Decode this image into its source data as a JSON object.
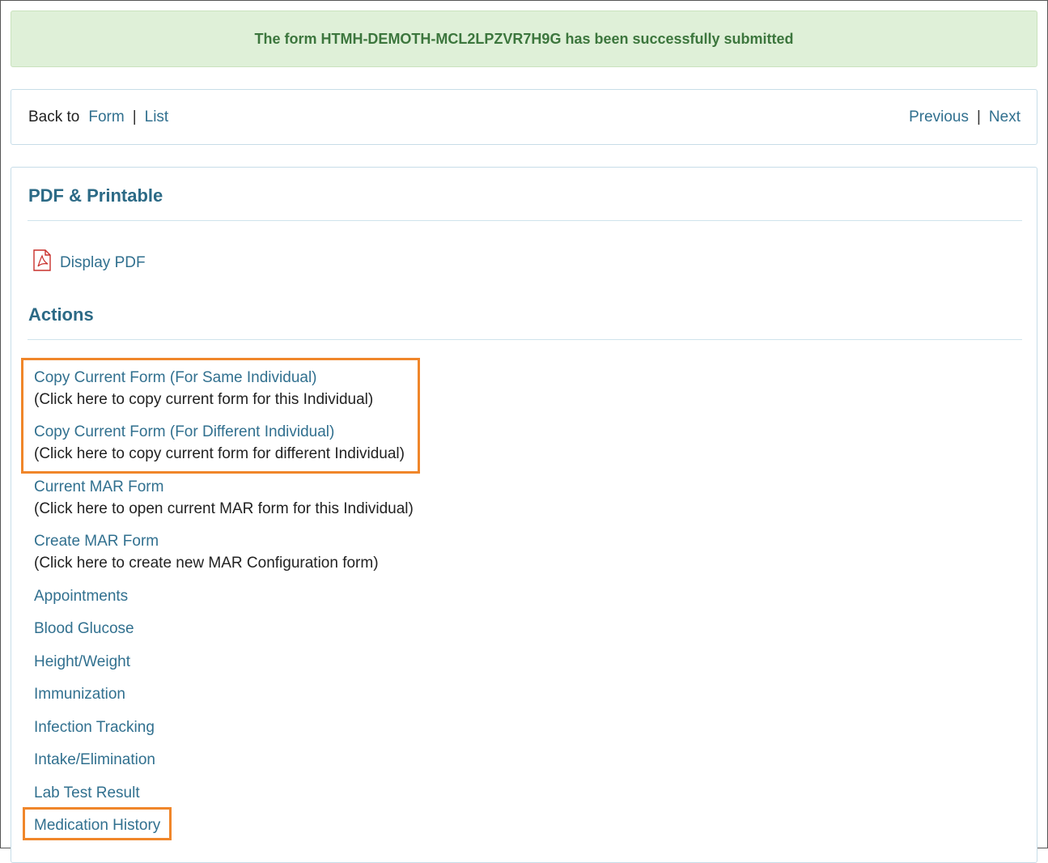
{
  "alert": {
    "message": "The form HTMH-DEMOTH-MCL2LPZVR7H9G has been successfully submitted"
  },
  "nav": {
    "back_label": "Back to",
    "form_link": "Form",
    "list_link": "List",
    "separator": "|",
    "previous_link": "Previous",
    "next_link": "Next"
  },
  "pdf_section": {
    "title": "PDF & Printable",
    "display_pdf": "Display PDF",
    "icon": "pdf-icon"
  },
  "actions_section": {
    "title": "Actions",
    "items": [
      {
        "label": "Copy Current Form (For Same Individual)",
        "desc": "(Click here to copy current form for this Individual)"
      },
      {
        "label": "Copy Current Form (For Different Individual)",
        "desc": "(Click here to copy current form for different Individual)"
      },
      {
        "label": "Current MAR Form",
        "desc": "(Click here to open current MAR form for this Individual)"
      },
      {
        "label": "Create MAR Form",
        "desc": "(Click here to create new MAR Configuration form)"
      },
      {
        "label": "Appointments"
      },
      {
        "label": "Blood Glucose"
      },
      {
        "label": "Height/Weight"
      },
      {
        "label": "Immunization"
      },
      {
        "label": "Infection Tracking"
      },
      {
        "label": "Intake/Elimination"
      },
      {
        "label": "Lab Test Result"
      },
      {
        "label": "Medication History"
      }
    ]
  },
  "colors": {
    "link": "#31708f",
    "heading": "#2c6a86",
    "success_bg": "#dff0d8",
    "success_text": "#3c763d",
    "highlight": "#f0862a"
  }
}
